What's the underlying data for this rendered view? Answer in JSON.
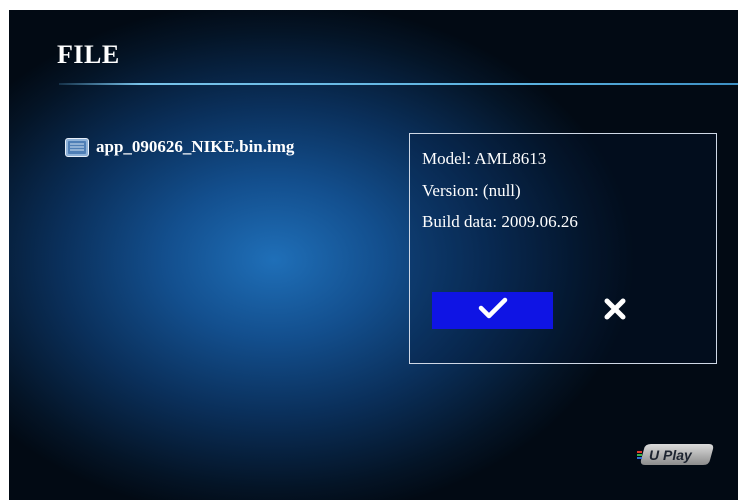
{
  "header": {
    "title": "FILE"
  },
  "file_list": {
    "items": [
      {
        "name": "app_090626_NIKE.bin.img",
        "icon": "file-icon"
      }
    ]
  },
  "dialog": {
    "model_line": "Model: AML8613",
    "version_line": "Version: (null)",
    "build_line": "Build data: 2009.06.26",
    "confirm_icon": "checkmark-icon",
    "cancel_icon": "close-icon"
  },
  "brand": {
    "logo_text": "U Play"
  },
  "colors": {
    "confirm_button": "#0f14e4",
    "text": "#ffffff",
    "title_rule": "#5ab1df"
  }
}
